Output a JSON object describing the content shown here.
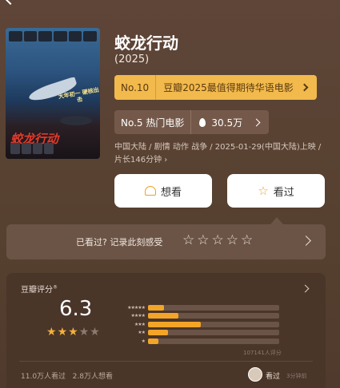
{
  "movie": {
    "title": "蛟龙行动",
    "year": "(2025)",
    "poster": {
      "tagline": "大年初一 硬核出击",
      "title_art": "蛟龙行动"
    },
    "meta": "中国大陆 / 剧情 动作 战争 / 2025-01-29(中国大陆)上映 / 片长146分钟"
  },
  "ranking": {
    "no": "No.10",
    "text": "豆瓣2025最值得期待华语电影"
  },
  "hot": {
    "no": "No.5 热门电影",
    "count": "30.5万"
  },
  "actions": {
    "want": "想看",
    "seen": "看过"
  },
  "rate_prompt": {
    "question": "已看过? 记录此刻感受",
    "stars": [
      "☆",
      "☆",
      "☆",
      "☆",
      "☆"
    ]
  },
  "rating": {
    "label": "豆瓣评分",
    "score": "6.3",
    "stars": 3,
    "distribution": [
      {
        "stars": "★★★★★",
        "pct": 0.12
      },
      {
        "stars": "★★★★",
        "pct": 0.23
      },
      {
        "stars": "★★★",
        "pct": 0.4
      },
      {
        "stars": "★★",
        "pct": 0.15
      },
      {
        "stars": "★",
        "pct": 0.08
      }
    ],
    "count_text": "107141人评分",
    "watched": "11.0万人看过",
    "wanted": "2.8万人想看",
    "friend_action": "看过",
    "friend_time": "3分钟前"
  },
  "colors": {
    "accent": "#f2b94c",
    "bar_fill": "#f2a526",
    "background": "#5b4436"
  }
}
